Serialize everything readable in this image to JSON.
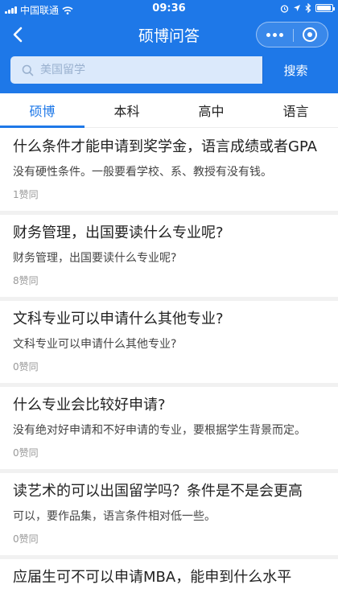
{
  "status_bar": {
    "carrier": "中国联通",
    "time": "09:36",
    "battery_icon": "battery-full-icon"
  },
  "nav": {
    "title": "硕博问答",
    "back_icon": "chevron-left-icon",
    "more_icon": "more-dots-icon",
    "close_icon": "target-circle-icon"
  },
  "search": {
    "placeholder": "美国留学",
    "button_label": "搜索"
  },
  "tabs": [
    {
      "label": "硕博",
      "active": true
    },
    {
      "label": "本科",
      "active": false
    },
    {
      "label": "高中",
      "active": false
    },
    {
      "label": "语言",
      "active": false
    }
  ],
  "questions": [
    {
      "title": "什么条件才能申请到奖学金，语言成绩或者GPA",
      "answer": "没有硬性条件。一般要看学校、系、教授有没有钱。",
      "likes": "1赞同"
    },
    {
      "title": "财务管理，出国要读什么专业呢?",
      "answer": "财务管理，出国要读什么专业呢?",
      "likes": "8赞同"
    },
    {
      "title": "文科专业可以申请什么其他专业?",
      "answer": "文科专业可以申请什么其他专业?",
      "likes": "0赞同"
    },
    {
      "title": "什么专业会比较好申请?",
      "answer": "没有绝对好申请和不好申请的专业，要根据学生背景而定。",
      "likes": "0赞同"
    },
    {
      "title": "读艺术的可以出国留学吗？条件是不是会更高",
      "answer": "可以，要作品集，语言条件相对低一些。",
      "likes": "0赞同"
    },
    {
      "title": "应届生可不可以申请MBA，能申到什么水平",
      "answer": "",
      "likes": ""
    }
  ],
  "colors": {
    "brand_blue": "#1e78e8",
    "search_bg": "#dbe9fb"
  }
}
